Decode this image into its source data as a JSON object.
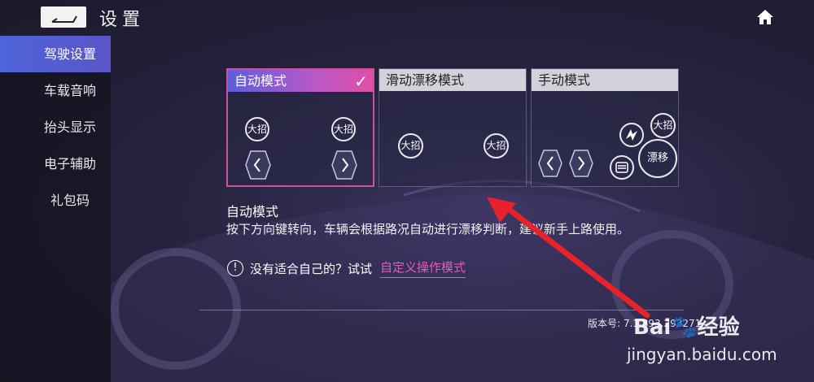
{
  "header": {
    "title": "设置",
    "back_icon": "back-arrow-icon",
    "home_icon": "home-icon"
  },
  "sidebar": {
    "items": [
      {
        "label": "驾驶设置",
        "active": true
      },
      {
        "label": "车载音响",
        "active": false
      },
      {
        "label": "抬头显示",
        "active": false
      },
      {
        "label": "电子辅助",
        "active": false
      },
      {
        "label": "礼包码",
        "active": false
      }
    ]
  },
  "modes": [
    {
      "label": "自动模式",
      "selected": true,
      "buttons": [
        "大招",
        "大招"
      ]
    },
    {
      "label": "滑动漂移模式",
      "selected": false,
      "buttons": [
        "大招",
        "大招"
      ]
    },
    {
      "label": "手动模式",
      "selected": false,
      "buttons": [
        "大招",
        "漂移"
      ]
    }
  ],
  "description": {
    "title": "自动模式",
    "text": "按下方向键转向，车辆会根据路况自动进行漂移判断，建议新手上路使用。"
  },
  "hint": {
    "text": "没有适合自己的？试试",
    "link": "自定义操作模式"
  },
  "version_text": "版本号: 7.1.893.293271",
  "watermark": {
    "logo": "Bai🐾经验",
    "url": "jingyan.baidu.com"
  },
  "colors": {
    "accent_active": "#5560d4",
    "link_pink": "#e25bb8",
    "annotation_red": "#e8222a"
  }
}
